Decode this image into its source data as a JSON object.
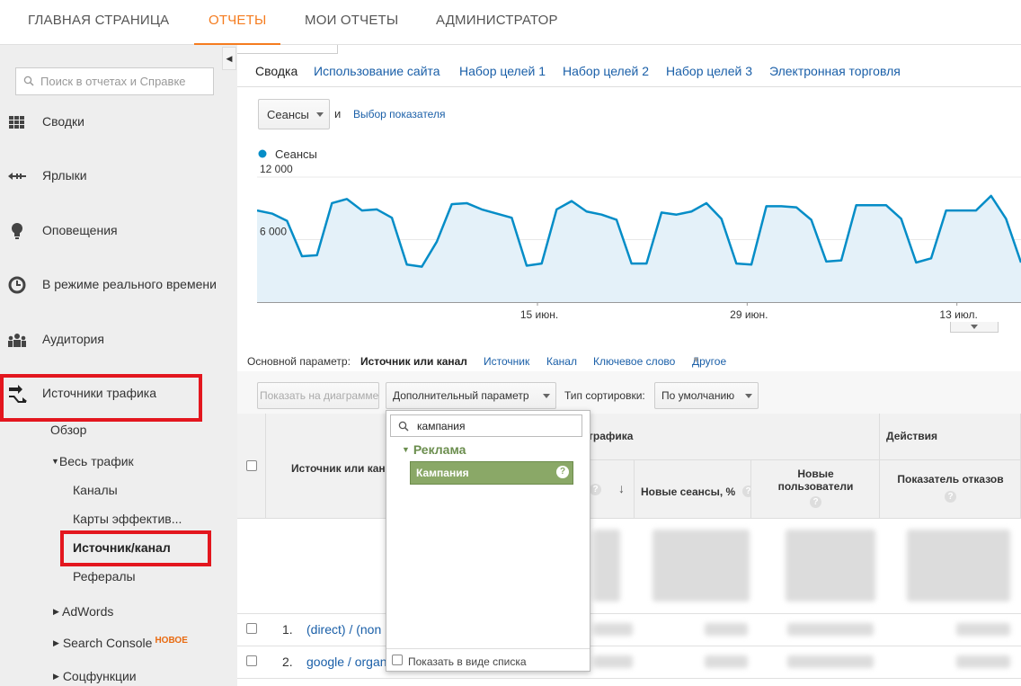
{
  "topnav": {
    "items": [
      "ГЛАВНАЯ СТРАНИЦА",
      "ОТЧЕТЫ",
      "МОИ ОТЧЕТЫ",
      "АДМИНИСТРАТОР"
    ],
    "active": "ОТЧЕТЫ"
  },
  "sidebar": {
    "search_placeholder": "Поиск в отчетах и Справке",
    "items": [
      {
        "label": "Сводки",
        "icon": "grid-icon"
      },
      {
        "label": "Ярлыки",
        "icon": "shortcut-arrow-icon"
      },
      {
        "label": "Оповещения",
        "icon": "lightbulb-icon"
      },
      {
        "label": "В режиме реального времени",
        "icon": "clock-icon"
      },
      {
        "label": "Аудитория",
        "icon": "people-icon"
      },
      {
        "label": "Источники трафика",
        "icon": "traffic-arrows-icon"
      }
    ],
    "sub": {
      "overview": "Обзор",
      "all_traffic": "Весь трафик",
      "channels": "Каналы",
      "treemaps": "Карты эффектив...",
      "source_medium": "Источник/канал",
      "referrals": "Рефералы",
      "adwords": "AdWords",
      "search_console": "Search Console",
      "new_badge": "НОВОЕ",
      "social": "Соцфункции"
    }
  },
  "tabs": [
    "Сводка",
    "Использование сайта",
    "Набор целей 1",
    "Набор целей 2",
    "Набор целей 3",
    "Электронная торговля"
  ],
  "metric_bar": {
    "metric": "Сеансы",
    "and": "и",
    "choose_metric": "Выбор показателя"
  },
  "chart_data": {
    "type": "area",
    "series": [
      {
        "name": "Сеансы",
        "values": [
          8800,
          8500,
          7800,
          4400,
          4500,
          9500,
          9900,
          8800,
          8900,
          8100,
          3600,
          3400,
          5800,
          9400,
          9500,
          8900,
          8500,
          8100,
          3500,
          3700,
          8900,
          9700,
          8700,
          8400,
          7900,
          3700,
          3700,
          8600,
          8400,
          8700,
          9500,
          8000,
          3700,
          3600,
          9200,
          9200,
          9100,
          7900,
          3900,
          4000,
          9300,
          9300,
          9300,
          8000,
          3800,
          4200,
          8800,
          8800,
          8800,
          10200,
          8000,
          3800
        ]
      }
    ],
    "x_ticks": [
      "15 июн.",
      "29 июн.",
      "13 июл."
    ],
    "y_ticks": [
      "12 000",
      "6 000"
    ],
    "ylim": [
      0,
      12000
    ],
    "color": "#058dc7",
    "fill_color": "#e4f1f9",
    "legend": "top-left"
  },
  "dimensions": {
    "label": "Основной параметр:",
    "active": "Источник или канал",
    "links": [
      "Источник",
      "Канал",
      "Ключевое слово"
    ],
    "other": "Другое"
  },
  "toolbar": {
    "plot_rows": "Показать на диаграмме",
    "secondary_dim": "Дополнительный параметр",
    "sort_label": "Тип сортировки:",
    "sort_value": "По умолчанию"
  },
  "table": {
    "col_source": "Источник или кан",
    "group_acquisition": "трафика",
    "group_behavior": "Действия",
    "col_new_sessions": "Новые сеансы, %",
    "col_new_users": "Новые пользователи",
    "col_bounce": "Показатель отказов",
    "rows": [
      {
        "num": "1.",
        "label": "(direct) / (non"
      },
      {
        "num": "2.",
        "label": "google / organ"
      }
    ]
  },
  "dropdown": {
    "search_value": "кампания",
    "group": "Реклама",
    "option": "Кампания",
    "footer": "Показать в виде списка"
  }
}
